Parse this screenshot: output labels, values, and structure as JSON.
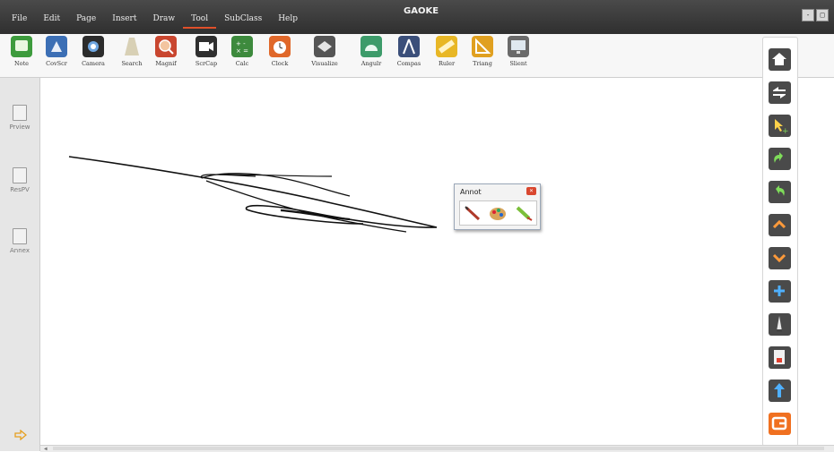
{
  "app": {
    "brand": "GAOKE"
  },
  "menu": [
    "File",
    "Edit",
    "Page",
    "Insert",
    "Draw",
    "Tool",
    "SubClass",
    "Help"
  ],
  "menu_active": "Tool",
  "window_buttons": [
    "-",
    "□"
  ],
  "toolbar": [
    {
      "label": "Note",
      "icon": "note-icon"
    },
    {
      "label": "CovScr",
      "icon": "cover-screen-icon"
    },
    {
      "label": "Camera",
      "icon": "camera-icon"
    },
    {
      "label": "Search",
      "icon": "spotlight-icon"
    },
    {
      "label": "Magnif",
      "icon": "magnifier-icon"
    },
    {
      "label": "ScrCap",
      "icon": "screen-capture-icon"
    },
    {
      "label": "Calc",
      "icon": "calculator-icon"
    },
    {
      "label": "Clock",
      "icon": "clock-icon"
    },
    {
      "label": "Visualize",
      "icon": "visualize-icon"
    },
    {
      "label": "Angulr",
      "icon": "protractor-icon"
    },
    {
      "label": "Compas",
      "icon": "compass-icon"
    },
    {
      "label": "Ruler",
      "icon": "ruler-icon"
    },
    {
      "label": "Triang",
      "icon": "triangle-icon"
    },
    {
      "label": "Slient",
      "icon": "monitor-icon"
    }
  ],
  "left_rail": [
    {
      "label": "Prview",
      "icon": "preview-icon"
    },
    {
      "label": "ResPV",
      "icon": "resource-preview-icon"
    },
    {
      "label": "Annex",
      "icon": "annex-icon"
    }
  ],
  "annot_popup": {
    "title": "Annot",
    "tools": [
      "pen-icon",
      "palette-icon",
      "highlighter-icon"
    ]
  },
  "right_dock": [
    {
      "icon": "home-icon",
      "color": "#2f8fd0"
    },
    {
      "icon": "swap-icon",
      "color": "#2f8fd0"
    },
    {
      "icon": "select-add-icon",
      "color": "#e0a020"
    },
    {
      "icon": "undo-icon",
      "color": "#3aa63a"
    },
    {
      "icon": "redo-icon",
      "color": "#3aa63a"
    },
    {
      "icon": "page-up-icon",
      "color": "#e07a20"
    },
    {
      "icon": "page-down-icon",
      "color": "#e07a20"
    },
    {
      "icon": "add-page-icon",
      "color": "#2f8fd0"
    },
    {
      "icon": "pen-tool-icon",
      "color": "#9a9a9a"
    },
    {
      "icon": "eraser-icon",
      "color": "#e04030"
    },
    {
      "icon": "upload-icon",
      "color": "#2f8fd0"
    },
    {
      "icon": "gaoke-logo-icon",
      "color": "#f07020"
    }
  ],
  "colors": {
    "titlebar": "#3a3a3a",
    "accent": "#e0502a",
    "dock_button": "#4a4a4a"
  }
}
